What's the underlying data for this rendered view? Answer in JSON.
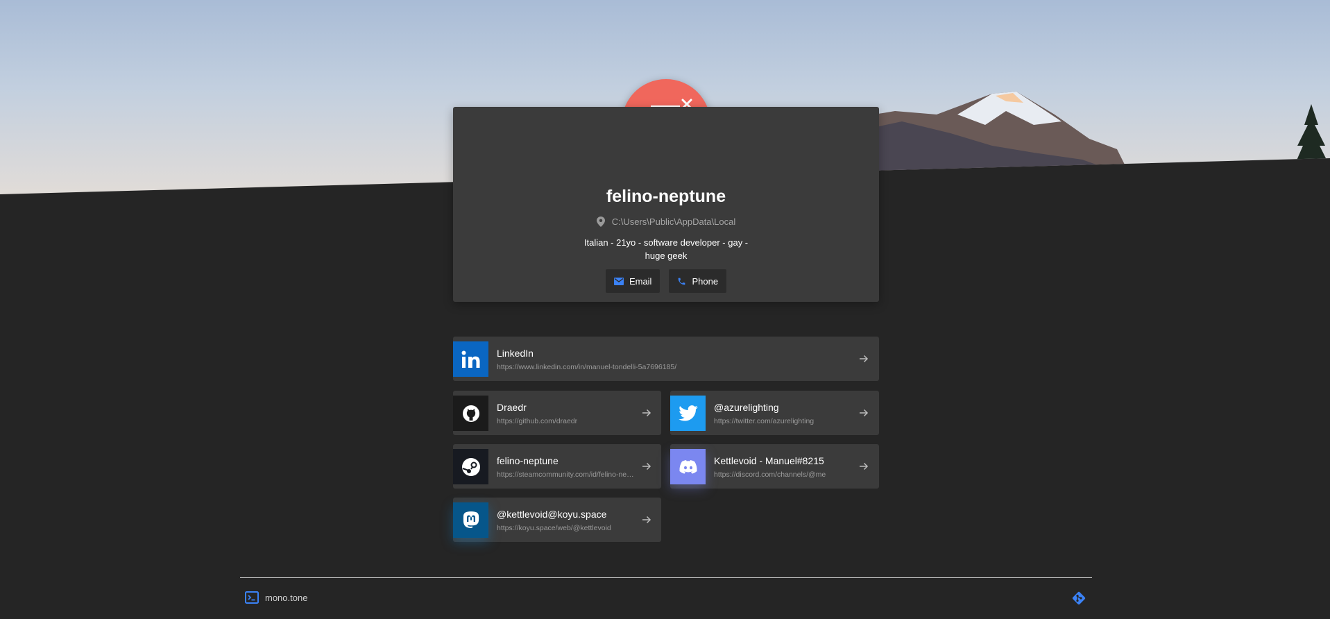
{
  "profile": {
    "name": "felino-neptune",
    "location": "C:\\Users\\Public\\AppData\\Local",
    "bio": "Italian - 21yo - software developer - gay - huge geek",
    "email_label": "Email",
    "phone_label": "Phone"
  },
  "links": [
    {
      "title": "LinkedIn",
      "url": "https://www.linkedin.com/in/manuel-tondelli-5a7696185/",
      "icon": "linkedin-icon",
      "color": "#0a66c2"
    },
    {
      "title": "Draedr",
      "url": "https://github.com/draedr",
      "icon": "github-icon",
      "color": "#1b1b1b"
    },
    {
      "title": "@azurelighting",
      "url": "https://twitter.com/azurelighting",
      "icon": "twitter-icon",
      "color": "#1d9bf0"
    },
    {
      "title": "felino-neptune",
      "url": "https://steamcommunity.com/id/felino-neptune/",
      "icon": "steam-icon",
      "color": "#171a21"
    },
    {
      "title": "Kettlevoid - Manuel#8215",
      "url": "https://discord.com/channels/@me",
      "icon": "discord-icon",
      "color": "#7b87f0"
    },
    {
      "title": "@kettlevoid@koyu.space",
      "url": "https://koyu.space/web/@kettlevoid",
      "icon": "mastodon-icon",
      "color": "#06568a"
    }
  ],
  "footer": {
    "brand": "mono.tone",
    "accent": "#3b82f6"
  },
  "colors": {
    "avatar": "#f0675c",
    "card": "#3b3b3b",
    "background": "#252525"
  }
}
